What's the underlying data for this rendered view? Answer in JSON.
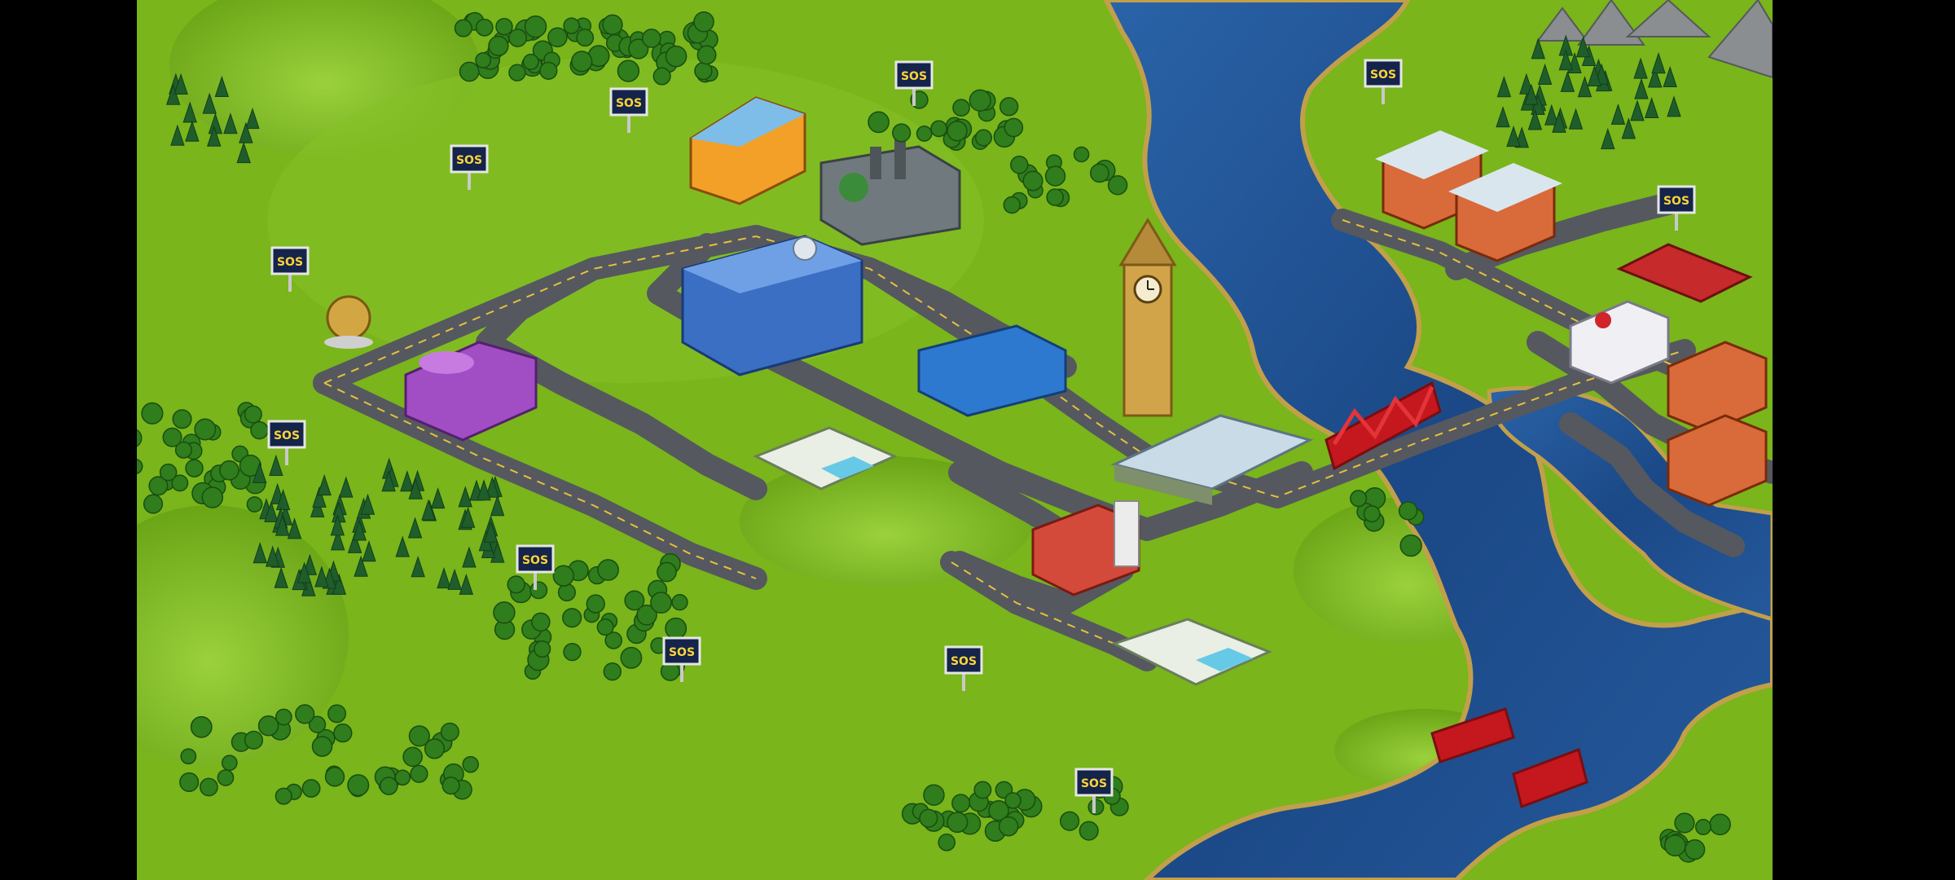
{
  "game": {
    "billboard_text": "SOS",
    "palette": {
      "grass": "#79b51b",
      "grass_dark": "#5f9a14",
      "grass_light": "#93c930",
      "water": "#1d4f8e",
      "water_light": "#3f7fc0",
      "road": "#55585f",
      "road_line": "#e6c13a",
      "tree": "#2f7d1c",
      "pine": "#1f5e2a",
      "bridge": "#c4181e",
      "tower": "#d1a44a",
      "billboard_bg": "#14244a",
      "billboard_text": "#ffd43a"
    }
  }
}
